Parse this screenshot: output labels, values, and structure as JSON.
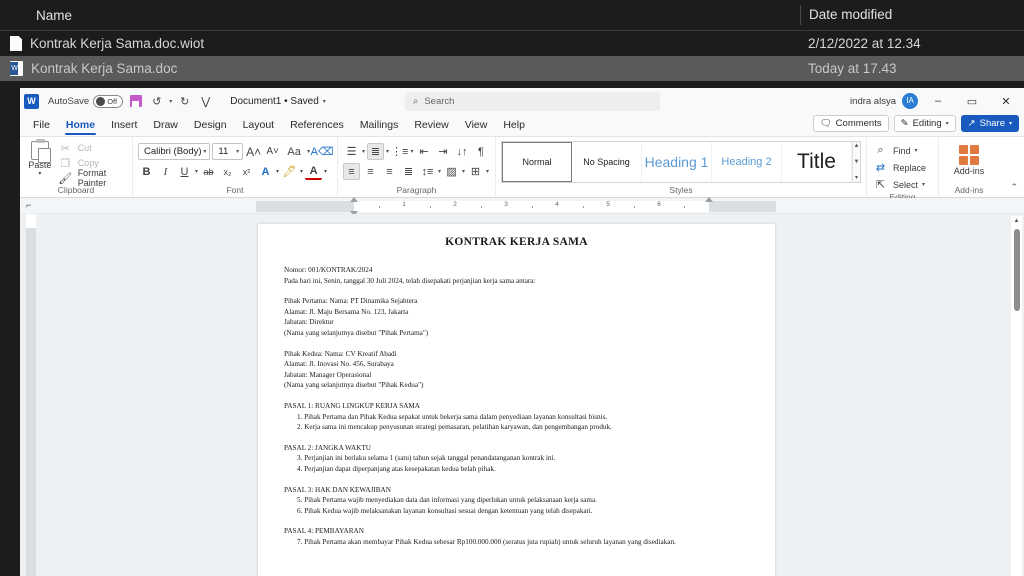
{
  "file_browser": {
    "columns": {
      "name": "Name",
      "date": "Date modified"
    },
    "rows": [
      {
        "icon": "plain-document-icon",
        "name": "Kontrak Kerja Sama.doc.wiot",
        "date": "2/12/2022 at 12.34",
        "selected": false
      },
      {
        "icon": "word-document-icon",
        "name": "Kontrak Kerja Sama.doc",
        "date": "Today at 17.43",
        "selected": true
      }
    ]
  },
  "word": {
    "title_bar": {
      "app_logo": "W",
      "autosave_label": "AutoSave",
      "autosave_state": "Off",
      "save_icon": "save-icon",
      "undo_icon": "undo-icon",
      "redo_icon": "redo-icon",
      "customize_icon": "customize-quick-access-icon",
      "document_title": "Document1 • Saved",
      "title_caret": "⌄",
      "search_placeholder": "Search",
      "search_icon": "search-icon",
      "user_name": "indra alsya",
      "user_initials": "IA",
      "minimize": "–",
      "restore": "▭",
      "close": "✕"
    },
    "tabs": [
      {
        "label": "File",
        "active": false
      },
      {
        "label": "Home",
        "active": true
      },
      {
        "label": "Insert",
        "active": false
      },
      {
        "label": "Draw",
        "active": false
      },
      {
        "label": "Design",
        "active": false
      },
      {
        "label": "Layout",
        "active": false
      },
      {
        "label": "References",
        "active": false
      },
      {
        "label": "Mailings",
        "active": false
      },
      {
        "label": "Review",
        "active": false
      },
      {
        "label": "View",
        "active": false
      },
      {
        "label": "Help",
        "active": false
      }
    ],
    "tab_right": {
      "comments": "Comments",
      "comments_icon": "comment-bubble-icon",
      "editing": "Editing",
      "editing_icon": "pencil-icon",
      "editing_caret": "⌄",
      "share": "Share",
      "share_icon": "share-icon",
      "share_caret": "⌄"
    },
    "ribbon": {
      "clipboard": {
        "group_label": "Clipboard",
        "paste": "Paste",
        "paste_caret": "⌄",
        "cut": "Cut",
        "copy": "Copy",
        "format_painter": "Format Painter",
        "launcher": "⌟"
      },
      "font": {
        "group_label": "Font",
        "font_name": "Calibri (Body)",
        "font_size": "11",
        "grow_font": "A",
        "shrink_font": "A",
        "change_case": "Aa",
        "clear_formatting": "A",
        "bold": "B",
        "italic": "I",
        "underline": "U",
        "strikethrough": "ab",
        "subscript": "x₂",
        "superscript": "x²",
        "text_effects": "A",
        "highlight": "highlighter-icon",
        "font_color": "A",
        "launcher": "⌟"
      },
      "paragraph": {
        "group_label": "Paragraph",
        "bullets": "bullet-list-icon",
        "numbering": "numbered-list-icon",
        "multilevel": "multilevel-list-icon",
        "decrease_indent": "decrease-indent-icon",
        "increase_indent": "increase-indent-icon",
        "sort": "sort-icon",
        "show_marks": "¶",
        "align_left": "align-left-icon",
        "align_center": "align-center-icon",
        "align_right": "align-right-icon",
        "justify": "justify-icon",
        "line_spacing": "line-spacing-icon",
        "shading": "shading-icon",
        "borders": "borders-icon",
        "launcher": "⌟"
      },
      "styles": {
        "group_label": "Styles",
        "items": [
          {
            "label": "Normal",
            "selected": true
          },
          {
            "label": "No Spacing",
            "selected": false
          },
          {
            "label": "Heading 1",
            "selected": false
          },
          {
            "label": "Heading 2",
            "selected": false
          },
          {
            "label": "Title",
            "selected": false
          }
        ],
        "scroll_up": "▲",
        "scroll_down": "▼",
        "more": "▾",
        "launcher": "⌟"
      },
      "editing": {
        "group_label": "Editing",
        "find": "Find",
        "find_icon": "magnifier-icon",
        "find_caret": "⌄",
        "replace": "Replace",
        "replace_icon": "replace-icon",
        "select": "Select",
        "select_icon": "select-icon",
        "select_caret": "⌄"
      },
      "addins": {
        "group_label": "Add-ins",
        "button_label": "Add-ins",
        "icon": "addins-grid-icon"
      },
      "collapse_ribbon": "⌃"
    },
    "ruler": {
      "marks": [
        "1",
        "2",
        "3",
        "4",
        "5",
        "6"
      ],
      "tab_stop_icon": "tab-stop-icon"
    },
    "document": {
      "heading": "KONTRAK KERJA SAMA",
      "blocks": [
        {
          "type": "p",
          "text": "Nomor: 001/KONTRAK/2024"
        },
        {
          "type": "p",
          "text": "Pada hari ini, Senin, tanggal 30 Juli 2024, telah disepakati perjanjian kerja sama antara:"
        },
        {
          "type": "gap"
        },
        {
          "type": "p",
          "text": "Pihak Pertama: Nama: PT Dinamika Sejahtera"
        },
        {
          "type": "p",
          "text": "Alamat: Jl. Maju Bersama No. 123, Jakarta"
        },
        {
          "type": "p",
          "text": "Jabatan: Direktur"
        },
        {
          "type": "p",
          "text": "(Nama yang selanjutnya disebut \"Pihak Pertama\")"
        },
        {
          "type": "gap"
        },
        {
          "type": "p",
          "text": "Pihak Kedua: Nama: CV Kreatif Abadi"
        },
        {
          "type": "p",
          "text": "Alamat: Jl. Inovasi No. 456, Surabaya"
        },
        {
          "type": "p",
          "text": "Jabatan: Manager Operasional"
        },
        {
          "type": "p",
          "text": "(Nama yang selanjutnya disebut \"Pihak Kedua\")"
        },
        {
          "type": "gap"
        },
        {
          "type": "head",
          "text": "PASAL 1: RUANG LINGKUP KERJA SAMA"
        },
        {
          "type": "li",
          "text": "1. Pihak Pertama dan Pihak Kedua sepakat untuk bekerja sama dalam penyediaan layanan konsultasi bisnis."
        },
        {
          "type": "li",
          "text": "2. Kerja sama ini mencakup penyusunan strategi pemasaran, pelatihan karyawan, dan pengembangan produk."
        },
        {
          "type": "gap"
        },
        {
          "type": "head",
          "text": "PASAL 2: JANGKA WAKTU"
        },
        {
          "type": "li",
          "text": "3. Perjanjian ini berlaku selama 1 (satu) tahun sejak tanggal penandatanganan kontrak ini."
        },
        {
          "type": "li",
          "text": "4. Perjanjian dapat diperpanjang atas kesepakatan kedua belah pihak."
        },
        {
          "type": "gap"
        },
        {
          "type": "head",
          "text": "PASAL 3: HAK DAN KEWAJIBAN"
        },
        {
          "type": "li",
          "text": "5. Pihak Pertama wajib menyediakan data dan informasi yang diperlukan untuk pelaksanaan kerja sama."
        },
        {
          "type": "li",
          "text": "6. Pihak Kedua wajib melaksanakan layanan konsultasi sesuai dengan ketentuan yang telah disepakati."
        },
        {
          "type": "gap"
        },
        {
          "type": "head",
          "text": "PASAL 4: PEMBAYARAN"
        },
        {
          "type": "li",
          "text": "7. Pihak Pertama akan membayar Pihak Kedua sebesar Rp100.000.000 (seratus juta rupiah) untuk seluruh layanan yang disediakan."
        }
      ]
    },
    "scrollbar": {
      "up_arrow": "▲"
    }
  },
  "colors": {
    "accent_blue": "#185abd",
    "heading_blue": "#5b9bd5",
    "desktop_dark": "#1c1c1c",
    "selection_grey": "#5a5a5a",
    "canvas_grey": "#eef1f3"
  }
}
